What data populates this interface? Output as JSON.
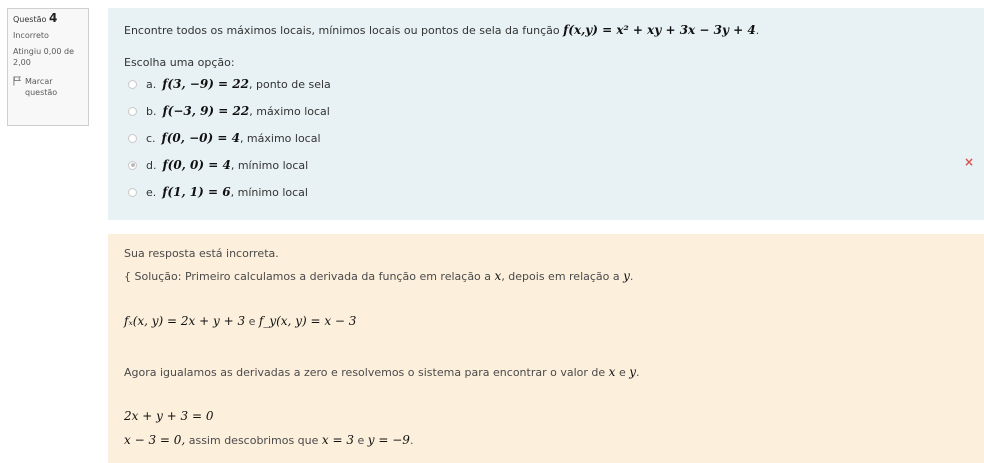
{
  "info": {
    "question_label": "Questão",
    "question_number": "4",
    "status": "Incorreto",
    "grade": "Atingiu 0,00 de 2,00",
    "flag_label": "Marcar questão"
  },
  "question": {
    "text": "Encontre todos os máximos locais, mínimos locais ou pontos de sela da função",
    "function_math": "f(x,y) = x² + xy + 3x − 3y + 4",
    "end": ".",
    "prompt": "Escolha uma opção:",
    "options": [
      {
        "letter": "a.",
        "math": "f(3, −9) = 22",
        "desc": ", ponto de sela",
        "checked": false
      },
      {
        "letter": "b.",
        "math": "f(−3, 9) = 22",
        "desc": ", máximo local",
        "checked": false
      },
      {
        "letter": "c.",
        "math": "f(0, −0) = 4",
        "desc": ", máximo local",
        "checked": false
      },
      {
        "letter": "d.",
        "math": "f(0, 0) = 4",
        "desc": ", mínimo local",
        "checked": true
      },
      {
        "letter": "e.",
        "math": "f(1, 1) = 6",
        "desc": ", mínimo local",
        "checked": false
      }
    ],
    "incorrect_mark": "×"
  },
  "feedback": {
    "line1": "Sua resposta está incorreta.",
    "line2_text": "{ Solução: Primeiro calculamos a derivada da função em relação a",
    "line2_x": "x",
    "line2_mid": ", depois em relação a",
    "line2_y": "y",
    "line2_end": ".",
    "deriv_fx": "fₓ(x, y) = 2x + y + 3",
    "deriv_e": "e",
    "deriv_fy": "f_y(x, y) = x − 3",
    "line4_text": "Agora igualamos as derivadas a zero e resolvemos o sistema para encontrar o valor de",
    "line4_x": "x",
    "line4_e": "e",
    "line4_y": "y",
    "line4_end": ".",
    "eq1": "2x + y + 3 = 0",
    "eq2": "x − 3 = 0,",
    "eq2_text": "assim descobrimos que",
    "eq2_x": "x = 3",
    "eq2_e": "e",
    "eq2_y": "y = −9",
    "eq2_end": "."
  },
  "colors": {
    "formulation_bg": "#e8f2f4",
    "feedback_bg": "#fcefdc",
    "incorrect": "#d9534f"
  }
}
